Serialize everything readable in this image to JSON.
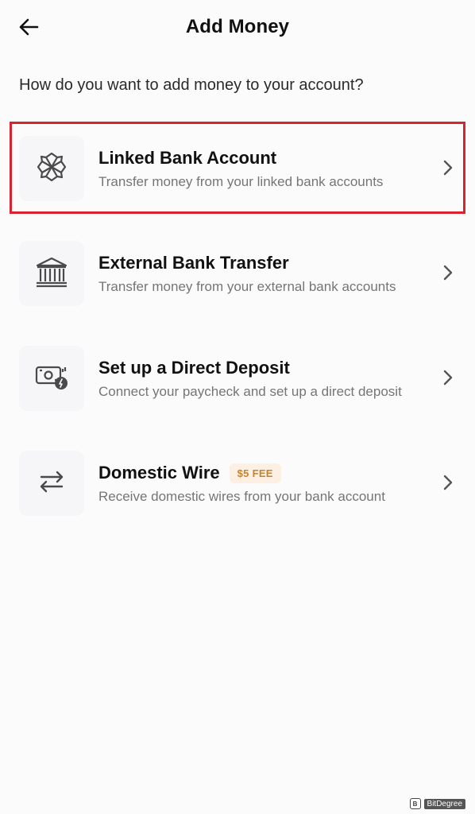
{
  "header": {
    "title": "Add Money",
    "back_icon": "arrow-left-icon"
  },
  "subtitle": "How do you want to add money to your account?",
  "options": [
    {
      "title": "Linked Bank Account",
      "description": "Transfer money from your linked bank accounts",
      "icon": "linked-bank-icon",
      "highlighted": true
    },
    {
      "title": "External Bank Transfer",
      "description": "Transfer money from your external bank accounts",
      "icon": "bank-building-icon"
    },
    {
      "title": "Set up a Direct Deposit",
      "description": "Connect your paycheck and set up a direct deposit",
      "icon": "paycheck-icon"
    },
    {
      "title": "Domestic Wire",
      "badge": "$5 FEE",
      "description": "Receive domestic wires from your bank account",
      "icon": "transfer-arrows-icon"
    }
  ],
  "watermark": {
    "text": "BitDegree"
  },
  "colors": {
    "highlight_border": "#d9232e",
    "badge_text": "#c8822d",
    "badge_bg": "#fdf0e2",
    "icon_bg": "#f6f5f8"
  }
}
